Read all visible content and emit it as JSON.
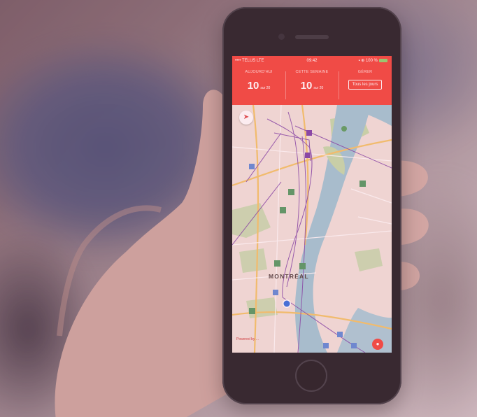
{
  "status_bar": {
    "carrier": "•••• TELUS LTE",
    "time": "09:42",
    "battery": "▪ ⊕ 100 %"
  },
  "header": {
    "col1_label": "AUJOURD'HUI",
    "col1_value": "10",
    "col1_unit": "sur 20",
    "col2_label": "CETTE SEMAINE",
    "col2_value": "10",
    "col2_unit": "sur 20",
    "col3_label": "GÉRER",
    "col3_button": "Tous les jours"
  },
  "map": {
    "city_label": "MONTRÉAL",
    "attribution": "Powered by ..."
  },
  "colors": {
    "accent": "#f2443a",
    "water": "#9ec7d6",
    "park": "#b8d7a2",
    "route": "#7b3fa8"
  },
  "icons": [
    "compass-icon",
    "location-dot-icon",
    "transit-icon",
    "action-fab-icon"
  ]
}
